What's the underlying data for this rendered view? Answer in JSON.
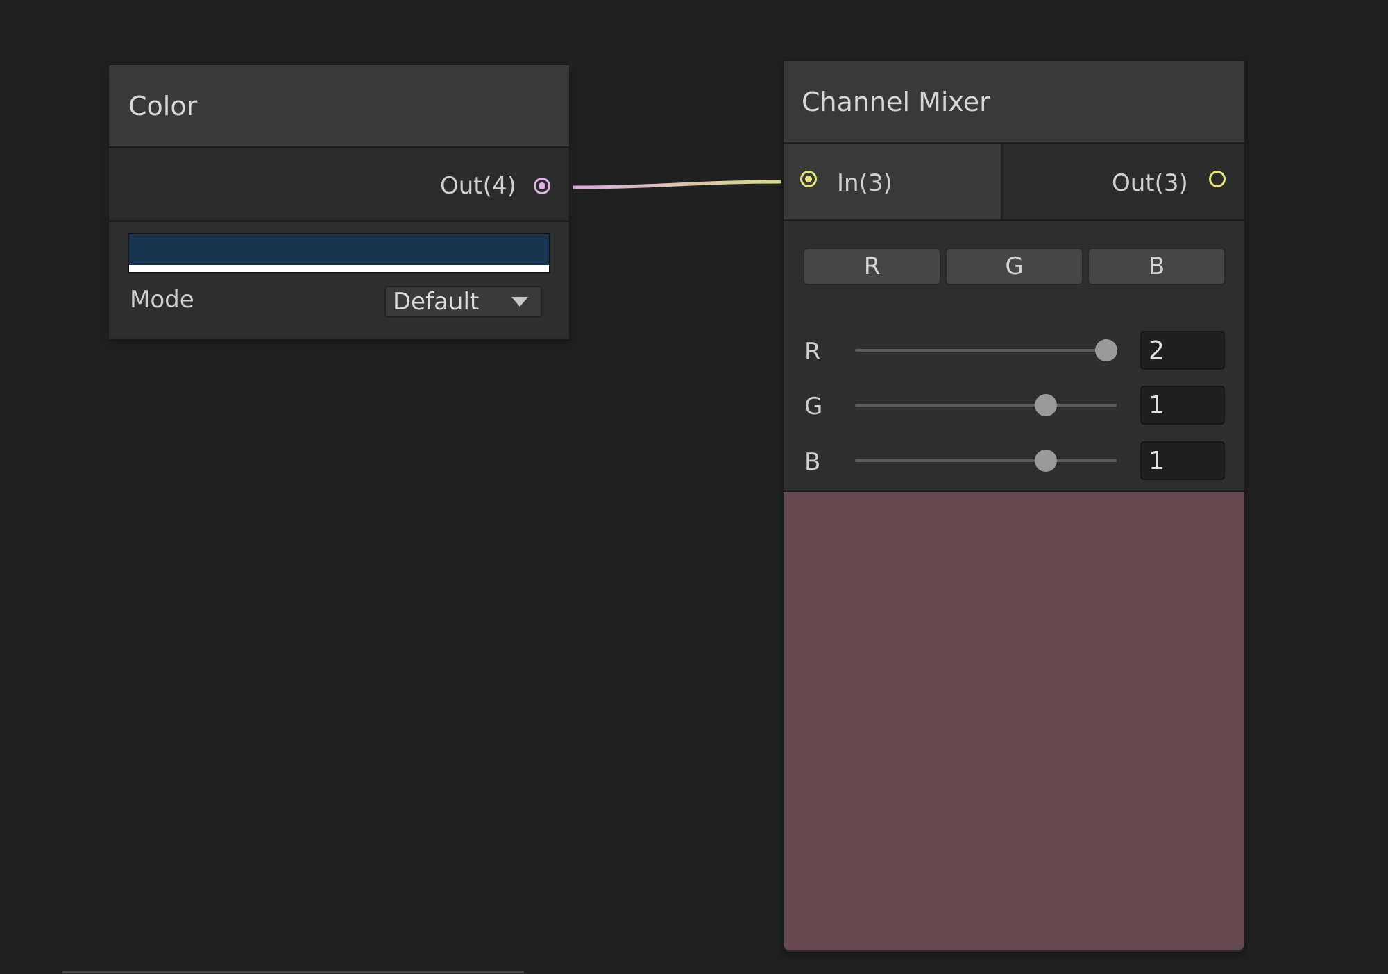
{
  "color_node": {
    "title": "Color",
    "output_port": "Out(4)",
    "swatch_color": "#1a3450",
    "mode_label": "Mode",
    "mode_value": "Default"
  },
  "mixer_node": {
    "title": "Channel Mixer",
    "input_port": "In(3)",
    "output_port": "Out(3)",
    "tabs": [
      "R",
      "G",
      "B"
    ],
    "sliders": [
      {
        "label": "R",
        "value": "2",
        "level": 0.96
      },
      {
        "label": "G",
        "value": "1",
        "level": 0.73
      },
      {
        "label": "B",
        "value": "1",
        "level": 0.73
      }
    ],
    "preview_color": "#654a4f"
  },
  "colors": {
    "port_vector4": "#e0b0e8",
    "port_vector3": "#e4e47a",
    "background": "#202020"
  }
}
